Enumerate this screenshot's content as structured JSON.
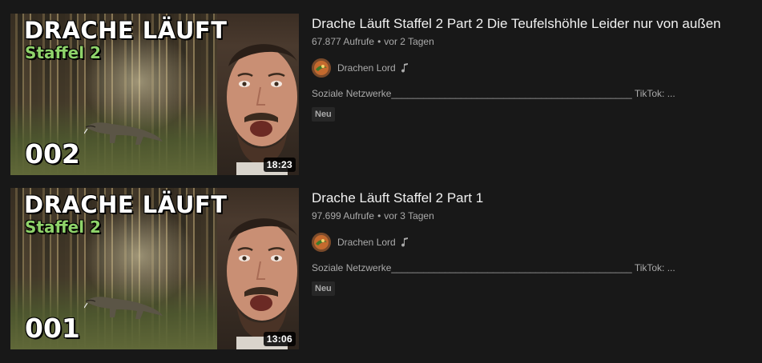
{
  "videos": [
    {
      "thumbnail": {
        "title": "DRACHE LÄUFT",
        "subtitle": "Staffel 2",
        "episode": "002",
        "duration": "18:23"
      },
      "title": "Drache Läuft Staffel 2 Part 2 Die Teufelshöhle Leider nur von außen",
      "views": "67.877 Aufrufe",
      "age": "vor 2 Tagen",
      "separator": "•",
      "channel": "Drachen Lord",
      "description": "Soziale Netzwerke_____________________________________________ TikTok: ...",
      "badge": "Neu"
    },
    {
      "thumbnail": {
        "title": "DRACHE LÄUFT",
        "subtitle": "Staffel 2",
        "episode": "001",
        "duration": "13:06"
      },
      "title": "Drache Läuft Staffel 2 Part 1",
      "views": "97.699 Aufrufe",
      "age": "vor 3 Tagen",
      "separator": "•",
      "channel": "Drachen Lord",
      "description": "Soziale Netzwerke_____________________________________________ TikTok: ...",
      "badge": "Neu"
    }
  ],
  "colors": {
    "background": "#181818",
    "title_text": "#f1f1f1",
    "secondary_text": "#aaaaaa",
    "badge_bg": "#272727",
    "subtitle_green": "#8fd36a"
  },
  "icons": {
    "music_note": "music-note-icon",
    "avatar": "channel-avatar"
  }
}
